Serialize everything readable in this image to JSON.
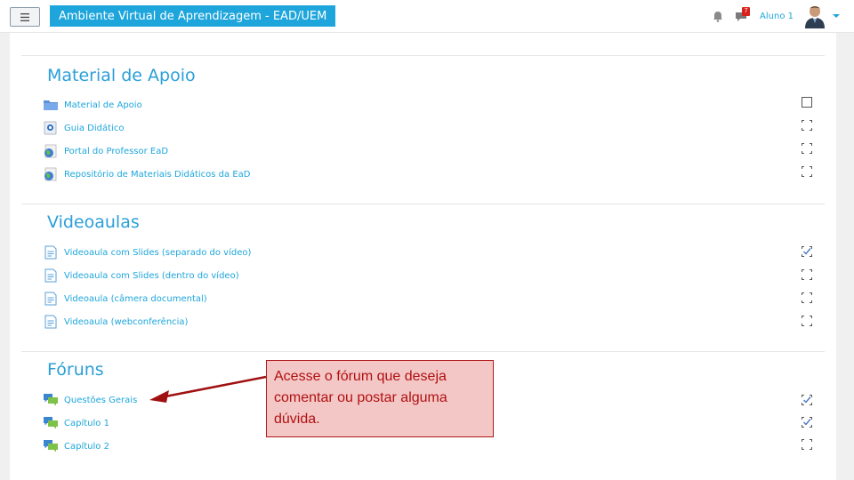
{
  "header": {
    "menu_icon": "hamburger-icon",
    "site_title": "Ambiente Virtual de Aprendizagem - EAD/UEM",
    "notifications_icon": "bell-icon",
    "messages_icon": "chat-icon",
    "messages_count": "7",
    "user_name": "Aluno 1",
    "avatar_icon": "user-avatar-icon",
    "user_menu_icon": "caret-down-icon"
  },
  "colors": {
    "accent": "#1ea6dc",
    "section_title": "#2a9fd8",
    "callout_bg": "#f4c7c7",
    "callout_text": "#b01010"
  },
  "sections": [
    {
      "title": "Material de Apoio",
      "activities": [
        {
          "label": "Material de Apoio",
          "icon": "folder-icon",
          "completion": "manual-unchecked"
        },
        {
          "label": "Guia Didático",
          "icon": "file-icon",
          "completion": "auto-unchecked"
        },
        {
          "label": "Portal do Professor EaD",
          "icon": "url-globe-icon",
          "completion": "auto-unchecked"
        },
        {
          "label": "Repositório de Materiais Didáticos da EaD",
          "icon": "url-globe-icon",
          "completion": "auto-unchecked"
        }
      ]
    },
    {
      "title": "Videoaulas",
      "activities": [
        {
          "label": "Videoaula com Slides (separado do vídeo)",
          "icon": "page-icon",
          "completion": "auto-checked"
        },
        {
          "label": "Videoaula com Slides (dentro do vídeo)",
          "icon": "page-icon",
          "completion": "auto-unchecked"
        },
        {
          "label": "Videoaula (câmera documental)",
          "icon": "page-icon",
          "completion": "auto-unchecked"
        },
        {
          "label": "Videoaula (webconferência)",
          "icon": "page-icon",
          "completion": "auto-unchecked"
        }
      ]
    },
    {
      "title": "Fóruns",
      "activities": [
        {
          "label": "Questões Gerais",
          "icon": "forum-icon",
          "completion": "auto-checked"
        },
        {
          "label": "Capítulo 1",
          "icon": "forum-icon",
          "completion": "auto-checked"
        },
        {
          "label": "Capítulo 2",
          "icon": "forum-icon",
          "completion": "auto-unchecked"
        }
      ]
    }
  ],
  "callout": {
    "lines": [
      "Acesse o fórum que deseja",
      "comentar ou postar alguma",
      "dúvida."
    ]
  }
}
